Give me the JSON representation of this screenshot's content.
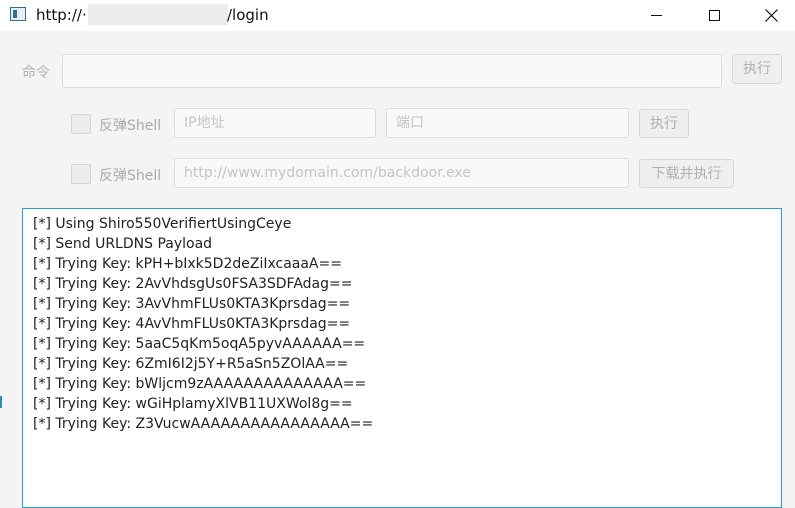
{
  "window": {
    "title_prefix": "http://·",
    "title_suffix": "/login"
  },
  "command_row": {
    "label": "命令",
    "value": "",
    "execute_label": "执行"
  },
  "reverse_shell_row": {
    "checkbox_label": "反弹Shell",
    "checked": false,
    "ip_placeholder": "IP地址",
    "port_placeholder": "端口",
    "execute_label": "执行"
  },
  "download_row": {
    "checkbox_label": "反弹Shell",
    "checked": false,
    "url_placeholder": "http://www.mydomain.com/backdoor.exe",
    "execute_label": "下载并执行"
  },
  "output": {
    "lines": [
      "[*] Using Shiro550VerifiertUsingCeye",
      "[*] Send URLDNS Payload",
      "[*] Trying Key: kPH+bIxk5D2deZiIxcaaaA==",
      "[*] Trying Key: 2AvVhdsgUs0FSA3SDFAdag==",
      "[*] Trying Key: 3AvVhmFLUs0KTA3Kprsdag==",
      "[*] Trying Key: 4AvVhmFLUs0KTA3Kprsdag==",
      "[*] Trying Key: 5aaC5qKm5oqA5pyvAAAAAA==",
      "[*] Trying Key: 6ZmI6I2j5Y+R5aSn5ZOlAA==",
      "[*] Trying Key: bWljcm9zAAAAAAAAAAAAAA==",
      "[*] Trying Key: wGiHplamyXlVB11UXWol8g==",
      "[*] Trying Key: Z3VucwAAAAAAAAAAAAAAAA=="
    ]
  }
}
